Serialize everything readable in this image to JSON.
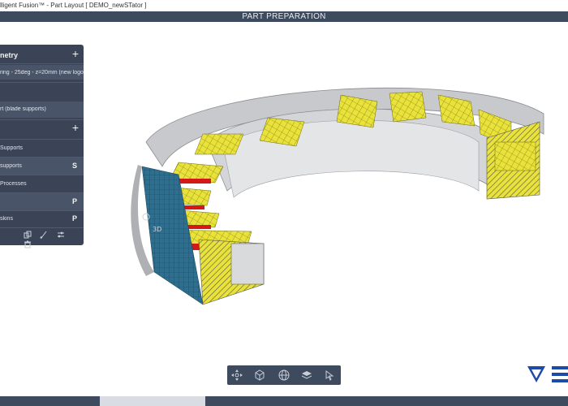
{
  "window": {
    "title": "lligent Fusion™ - Part Layout [ DEMO_newSTator ]"
  },
  "header": {
    "title": "PART PREPARATION"
  },
  "panel": {
    "geometry_title": "netry",
    "geometry_plus": "+",
    "geometry_item": "ring - 25deg - z=20mm (new logo...",
    "part_item": "rt (blade supports)",
    "section2_plus": "+",
    "items": [
      {
        "label": "Supports",
        "tag": ""
      },
      {
        "label": "supports",
        "tag": "S"
      },
      {
        "label": "Processes",
        "tag": ""
      },
      {
        "label": "",
        "tag": "P"
      },
      {
        "label": "skins",
        "tag": "P"
      }
    ],
    "footer_icons": [
      "copy-icon",
      "brush-icon",
      "sliders-icon",
      "trash-icon"
    ]
  },
  "toolbar": {
    "icons": [
      "move-icon",
      "cube-icon",
      "globe-icon",
      "layers-icon",
      "cursor-icon"
    ]
  },
  "logo": {
    "text": "V E"
  },
  "colors": {
    "panel_bg": "#3b4456",
    "header_bg": "#3e4a5e",
    "mesh_yellow": "#e8e23a",
    "mesh_blue": "#2e6f8f",
    "support_red": "#d41818",
    "part_grey": "#c7c9cc",
    "logo_blue": "#1d4aa8"
  }
}
